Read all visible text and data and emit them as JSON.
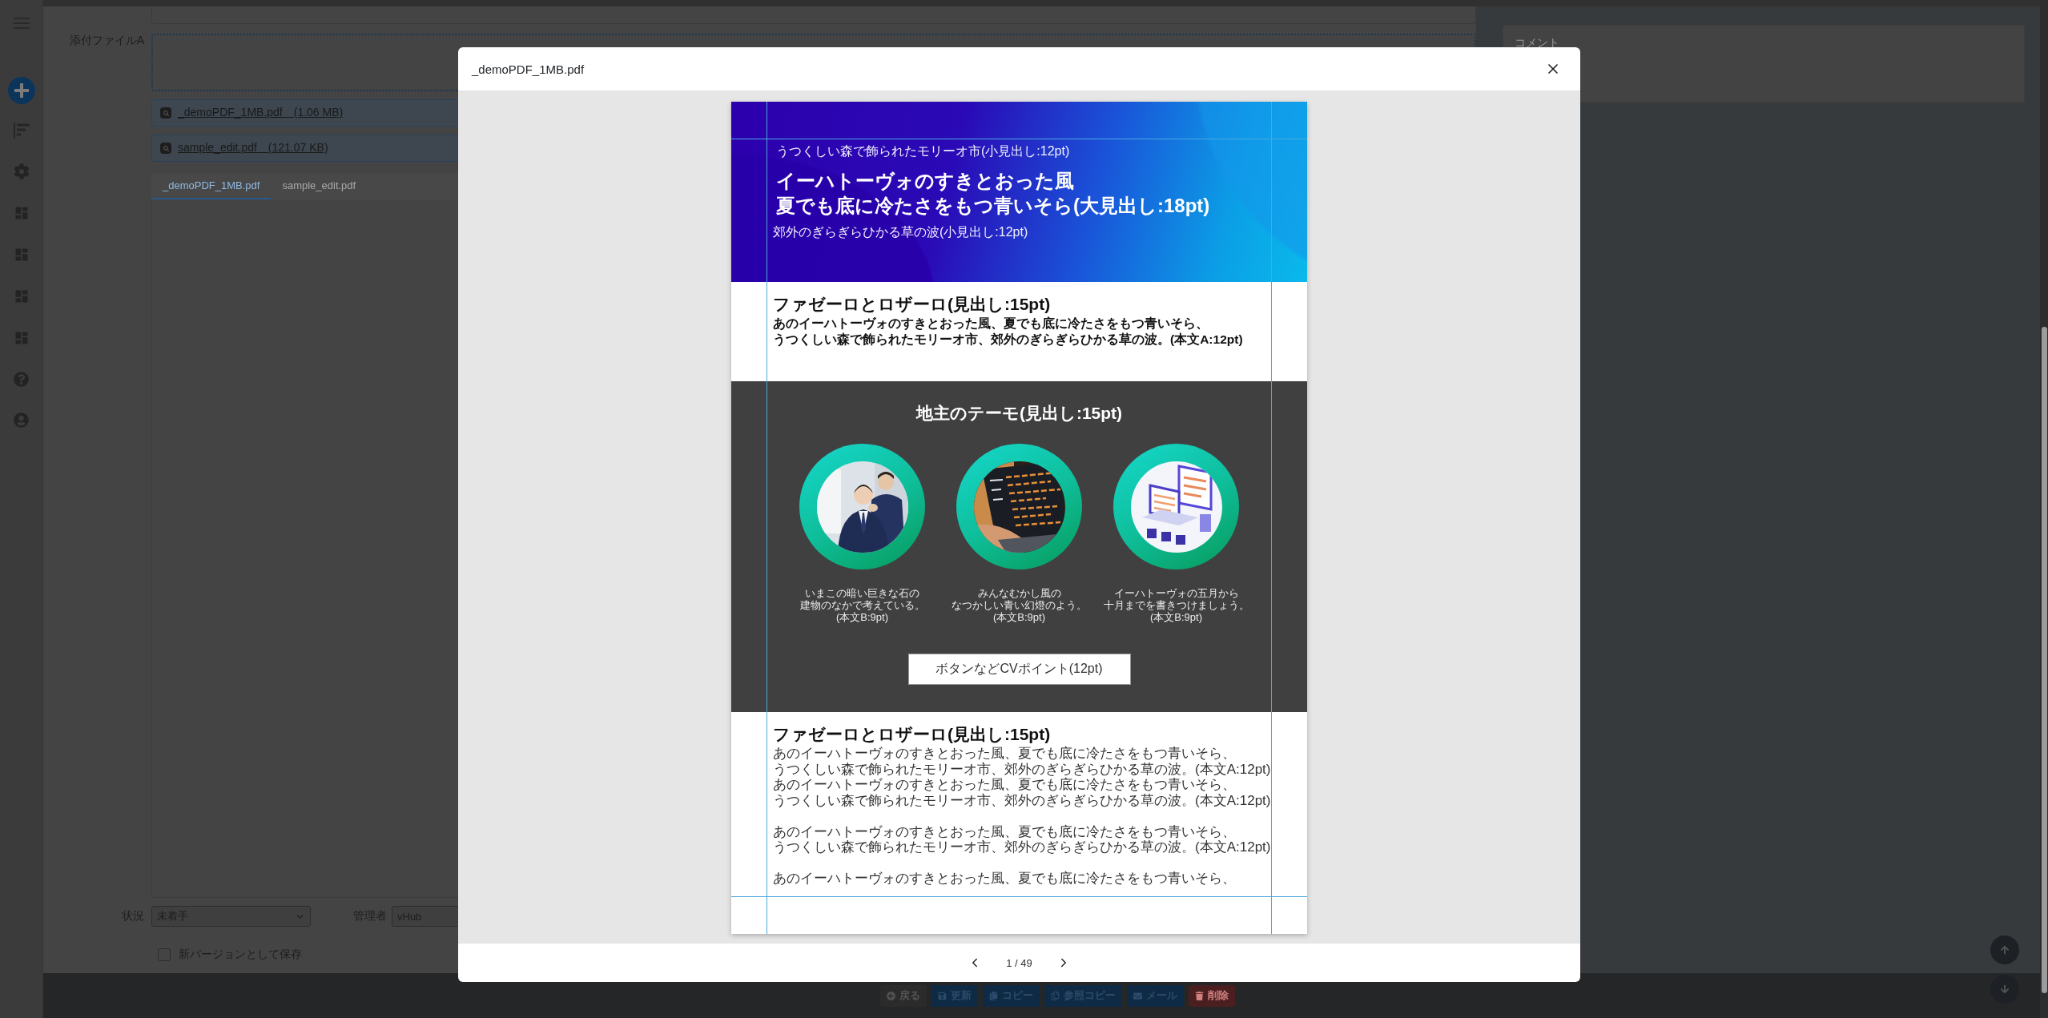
{
  "form": {
    "top_field": {
      "kind": "text"
    },
    "attachment": {
      "label": "添付ファイルA",
      "files": [
        {
          "name": "_demoPDF_1MB.pdf　(1.06 MB)"
        },
        {
          "name": "sample_edit.pdf　(121.07 KB)"
        }
      ],
      "tabs": [
        {
          "label": "_demoPDF_1MB.pdf",
          "selected": true
        },
        {
          "label": "sample_edit.pdf",
          "selected": false
        }
      ]
    },
    "status": {
      "label": "状況",
      "value": "未着手"
    },
    "manager": {
      "label": "管理者",
      "value": "vHub"
    },
    "new_version": {
      "label": "新バージョンとして保存",
      "checked": false
    }
  },
  "comment": {
    "placeholder": "コメント"
  },
  "actions": [
    {
      "label": "戻る",
      "kind": "back"
    },
    {
      "label": "更新",
      "kind": "update"
    },
    {
      "label": "コピー",
      "kind": "copy"
    },
    {
      "label": "参照コピー",
      "kind": "reference_copy"
    },
    {
      "label": "メール",
      "kind": "mail"
    },
    {
      "label": "削除",
      "kind": "delete"
    }
  ],
  "modal": {
    "title": "_demoPDF_1MB.pdf",
    "page": "1 / 49",
    "document": {
      "hero": {
        "kicker": "うつくしい森で飾られたモリーオ市(小見出し:12pt)",
        "title_lines": [
          "イーハトーヴォのすきとおった風",
          "夏でも底に冷たさをもつ青いそら(大見出し:18pt)"
        ],
        "subtitle": "郊外のぎらぎらひかる草の波(小見出し:12pt)"
      },
      "intro": {
        "heading": "ファゼーロとロザーロ(見出し:15pt)",
        "body_lines": [
          "あのイーハトーヴォのすきとおった風、夏でも底に冷たさをもつ青いそら、",
          "うつくしい森で飾られたモリーオ市、郊外のぎらぎらひかる草の波。(本文A:12pt)"
        ]
      },
      "feature": {
        "heading": "地主のテーモ(見出し:15pt)",
        "cards": [
          {
            "caption_lines": [
              "いまこの暗い巨きな石の",
              "建物のなかで考えている。",
              "(本文B:9pt)"
            ]
          },
          {
            "caption_lines": [
              "みんなむかし風の",
              "なつかしい青い幻燈のよう。",
              "(本文B:9pt)"
            ]
          },
          {
            "caption_lines": [
              "イーハトーヴォの五月から",
              "十月までを書きつけましょう。",
              "(本文B:9pt)"
            ]
          }
        ],
        "button": "ボタンなどCVポイント(12pt)"
      },
      "article": {
        "heading": "ファゼーロとロザーロ(見出し:15pt)",
        "paragraphs": [
          {
            "lines": [
              "あのイーハトーヴォのすきとおった風、夏でも底に冷たさをもつ青いそら、",
              "うつくしい森で飾られたモリーオ市、郊外のぎらぎらひかる草の波。(本文A:12pt)",
              "あのイーハトーヴォのすきとおった風、夏でも底に冷たさをもつ青いそら、",
              "うつくしい森で飾られたモリーオ市、郊外のぎらぎらひかる草の波。(本文A:12pt)"
            ]
          },
          {
            "lines": [
              "あのイーハトーヴォのすきとおった風、夏でも底に冷たさをもつ青いそら、",
              "うつくしい森で飾られたモリーオ市、郊外のぎらぎらひかる草の波。(本文A:12pt)"
            ]
          },
          {
            "lines": [
              "あのイーハトーヴォのすきとおった風、夏でも底に冷たさをもつ青いそら、"
            ]
          }
        ]
      }
    }
  }
}
